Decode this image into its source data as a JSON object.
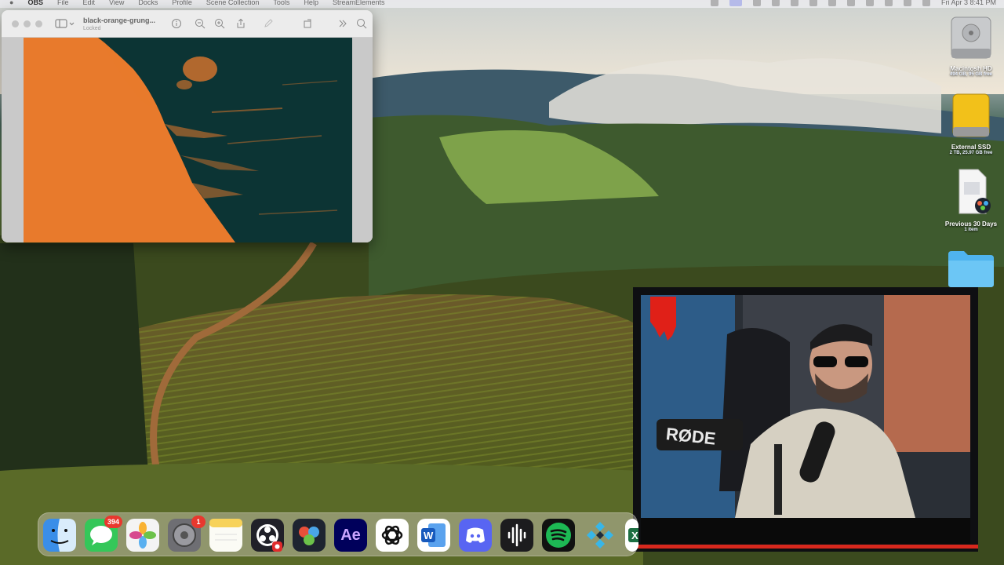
{
  "menubar": {
    "apple": "",
    "app_name": "OBS",
    "menus": [
      "File",
      "Edit",
      "View",
      "Docks",
      "Profile",
      "Scene Collection",
      "Tools",
      "Help",
      "StreamElements"
    ],
    "clock": "Fri Apr 3  8:41 PM"
  },
  "preview_window": {
    "title": "black-orange-grung...",
    "subtitle": "Locked",
    "icons": [
      "sidebar-icon",
      "info-icon",
      "zoom-out-icon",
      "zoom-in-icon",
      "share-icon",
      "markup-icon",
      "rotate-icon",
      "more-icon",
      "search-icon"
    ]
  },
  "desktop": {
    "items": [
      {
        "label": "Macintosh HD",
        "sub": "494 GB, 95 GB free",
        "icon": "hard-drive-icon"
      },
      {
        "label": "External SSD",
        "sub": "2 TB, 25.97 GB free",
        "icon": "external-drive-icon"
      },
      {
        "label": "Previous 30 Days",
        "sub": "1 item",
        "icon": "stack-icon"
      },
      {
        "label": "",
        "sub": "",
        "icon": "folder-icon"
      }
    ]
  },
  "dock": {
    "apps": [
      {
        "name": "Finder",
        "icon": "finder-icon",
        "glyph": "",
        "color": "#3a8ee8"
      },
      {
        "name": "Messages",
        "icon": "messages-icon",
        "glyph": "",
        "color": "#34c759",
        "badge": "394"
      },
      {
        "name": "Photos",
        "icon": "photos-icon",
        "glyph": "",
        "color": "#f4f4f4"
      },
      {
        "name": "System Settings",
        "icon": "settings-icon",
        "glyph": "",
        "color": "#6e6e73",
        "badge": "1"
      },
      {
        "name": "Notes",
        "icon": "notes-icon",
        "glyph": "",
        "color": "#fbfbf5"
      },
      {
        "name": "OBS",
        "icon": "obs-icon",
        "glyph": "",
        "color": "#202028"
      },
      {
        "name": "DaVinci Resolve",
        "icon": "davinci-icon",
        "glyph": "",
        "color": "#1e2430"
      },
      {
        "name": "After Effects",
        "icon": "after-effects-icon",
        "glyph": "Ae",
        "color": "#00005b"
      },
      {
        "name": "ChatGPT",
        "icon": "chatgpt-icon",
        "glyph": "",
        "color": "#ffffff"
      },
      {
        "name": "Word",
        "icon": "word-icon",
        "glyph": "",
        "color": "#2b6fd6"
      },
      {
        "name": "Discord",
        "icon": "discord-icon",
        "glyph": "",
        "color": "#5865f2"
      },
      {
        "name": "Voice Memos",
        "icon": "voice-memos-icon",
        "glyph": "",
        "color": "#1c1c1e"
      },
      {
        "name": "Spotify",
        "icon": "spotify-icon",
        "glyph": "",
        "color": "#1db954"
      },
      {
        "name": "Kodi",
        "icon": "kodi-icon",
        "glyph": "",
        "color": "#1f2b3a"
      },
      {
        "name": "Excel",
        "icon": "excel-icon",
        "glyph": "X",
        "color": "#1d6f42"
      }
    ]
  },
  "webcam": {
    "mic_brand": "RØDE"
  },
  "colors": {
    "grunge_bg": "#0c3434",
    "grunge_orange": "#e87a2c",
    "accent_red": "#d7281d"
  }
}
